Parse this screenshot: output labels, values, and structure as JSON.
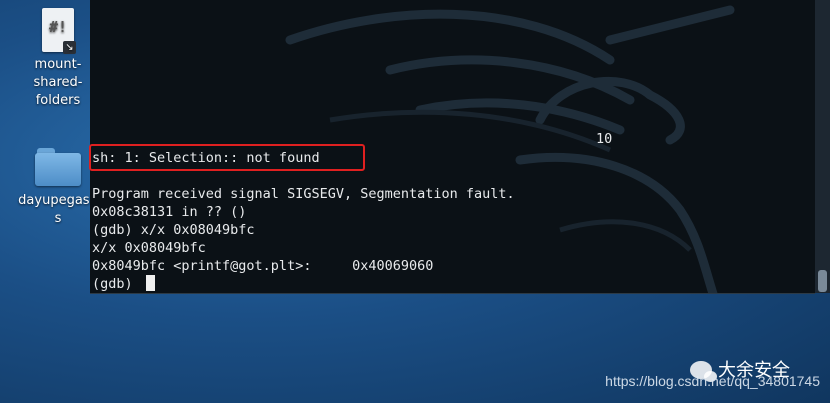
{
  "desktop": {
    "icons": [
      {
        "label": "mount-shared-folders",
        "label_lines": [
          "mount-",
          "shared-",
          "folders"
        ]
      },
      {
        "label": "dayupegasus",
        "label_lines": [
          "dayupegasu",
          "s"
        ]
      }
    ]
  },
  "terminal": {
    "lines": [
      "sh: 1: Selection:: not found",
      "",
      "Program received signal SIGSEGV, Segmentation fault.",
      "0x08c38131 in ?? ()",
      "(gdb) x/x 0x08049bfc",
      "x/x 0x08049bfc",
      "0x8049bfc <printf@got.plt>:     0x40069060",
      "(gdb) "
    ],
    "floating_text": "10",
    "highlight_color": "#e02020"
  },
  "watermark": {
    "brand": "大余安全",
    "url": "https://blog.csdn.net/qq_34801745"
  }
}
